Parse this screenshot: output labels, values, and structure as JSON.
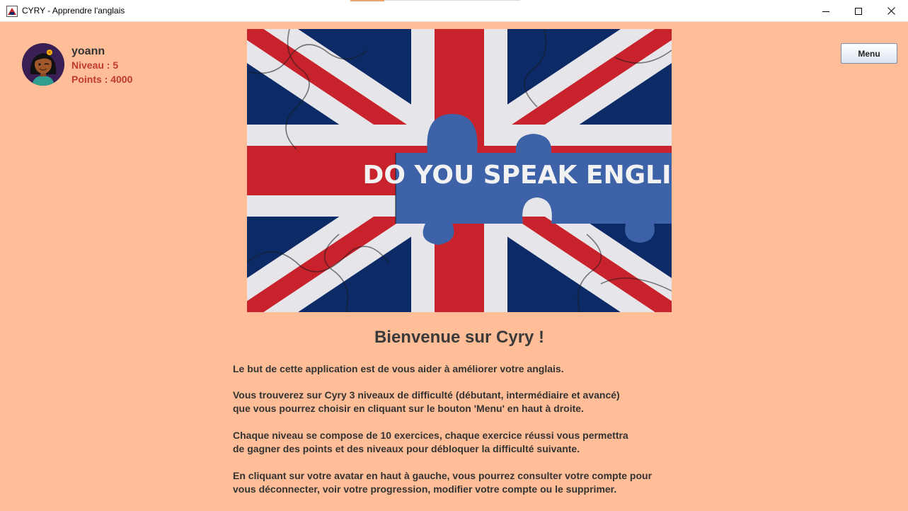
{
  "window": {
    "title": "CYRY - Apprendre l'anglais",
    "controls": [
      "minimize-icon",
      "maximize-icon",
      "close-icon"
    ]
  },
  "user": {
    "name": "yoann",
    "level": "Niveau : 5",
    "points": "Points : 4000",
    "avatar_icon": "avatar-girl-flower-icon"
  },
  "toolbar": {
    "menu_label": "Menu"
  },
  "banner": {
    "text": "DO YOU SPEAK ENGLISH?"
  },
  "welcome": {
    "title": "Bienvenue sur Cyry !",
    "paragraphs": [
      [
        "Le but de cette application est de vous aider à améliorer votre anglais."
      ],
      [
        "Vous trouverez sur Cyry 3 niveaux de difficulté (débutant, intermédiaire et avancé)",
        "que vous pourrez choisir en cliquant sur le bouton 'Menu' en haut à droite."
      ],
      [
        "Chaque niveau se compose de 10 exercices, chaque exercice réussi vous permettra",
        "de gagner des points et des niveaux pour débloquer la difficulté suivante."
      ],
      [
        "En cliquant sur votre avatar en haut à gauche, vous pourrez consulter votre compte pour",
        "vous déconnecter, voir votre progression, modifier votre compte ou le supprimer."
      ]
    ]
  },
  "colors": {
    "background": "#ffbe98",
    "accent_red": "#c0392b",
    "flag_blue": "#0b2a66",
    "flag_red": "#c8232c"
  }
}
